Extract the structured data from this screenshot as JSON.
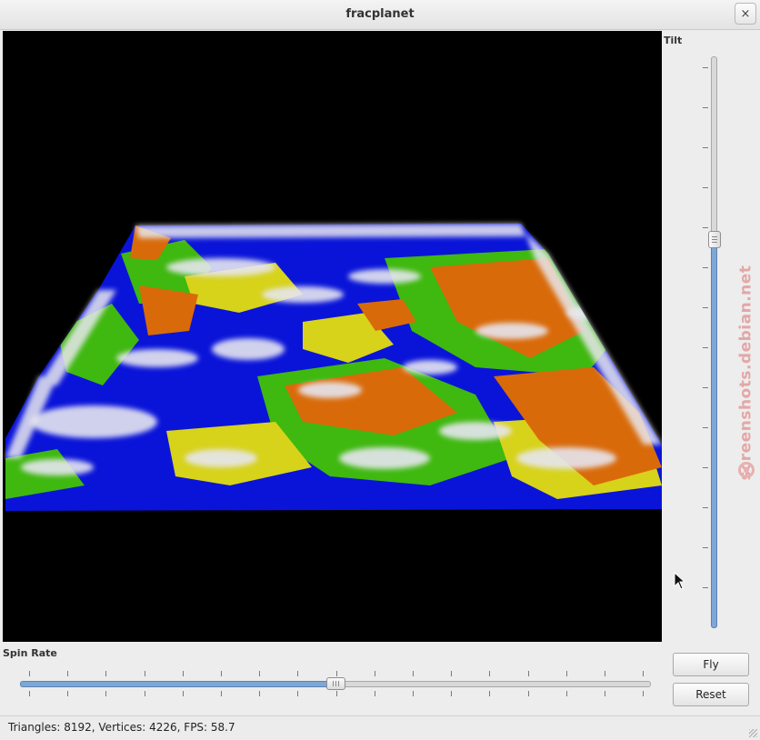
{
  "window": {
    "title": "fracplanet",
    "close_glyph": "×"
  },
  "controls": {
    "tilt_label": "Tilt",
    "tilt_level": 0.32,
    "spin_rate_label": "Spin Rate",
    "spin_rate_level": 0.5,
    "fly_label": "Fly",
    "reset_label": "Reset"
  },
  "status": {
    "text": "Triangles: 8192, Vertices: 4226, FPS: 58.7"
  },
  "watermark": {
    "text": "screenshots.debian.net"
  },
  "colors": {
    "water": "#0a14d8",
    "land_green": "#3fb80f",
    "land_yellow": "#d7d21a",
    "mountain_orange": "#d96a0a",
    "snow": "#e6e6f0",
    "slider_fill": "#7fa7d6"
  },
  "icons": {
    "close": "close-icon",
    "cursor": "mouse-pointer-icon",
    "watermark_logo": "debian-swirl-icon"
  }
}
